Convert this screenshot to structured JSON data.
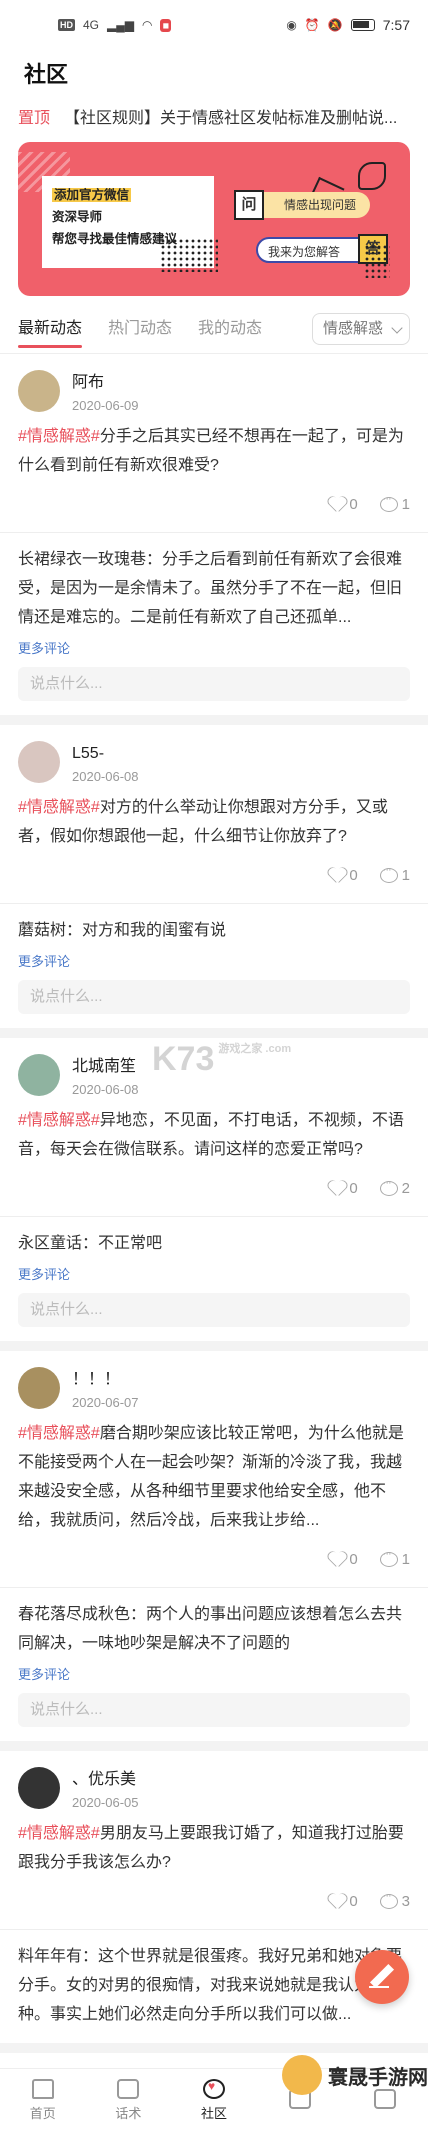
{
  "status_bar": {
    "left_badge": "HD",
    "signal": "4G",
    "time": "7:57"
  },
  "page_title": "社区",
  "notice": {
    "pin": "置顶",
    "text": "【社区规则】关于情感社区发帖标准及删帖说..."
  },
  "banner": {
    "line1": "添加官方微信",
    "line2": "资深导师",
    "line3": "帮您寻找最佳情感建议",
    "q_icon": "问",
    "q_text": "情感出现问题",
    "a_text": "我来为您解答",
    "a_icon": "答"
  },
  "tabs": {
    "items": [
      "最新动态",
      "热门动态",
      "我的动态"
    ],
    "select": "情感解惑"
  },
  "posts": [
    {
      "name": "阿布",
      "date": "2020-06-09",
      "tag": "#情感解惑#",
      "text": "分手之后其实已经不想再在一起了，可是为什么看到前任有新欢很难受?",
      "likes": "0",
      "comments": "1",
      "comment_user": "长裙绿衣一玫瑰巷：",
      "comment_text": "分手之后看到前任有新欢了会很难受，是因为一是余情未了。虽然分手了不在一起，但旧情还是难忘的。二是前任有新欢了自己还孤单...",
      "more": "更多评论",
      "reply_placeholder": "说点什么..."
    },
    {
      "name": "L55-",
      "date": "2020-06-08",
      "tag": "#情感解惑#",
      "text": "对方的什么举动让你想跟对方分手，又或者，假如你想跟他一起，什么细节让你放弃了?",
      "likes": "0",
      "comments": "1",
      "comment_user": "蘑菇树：",
      "comment_text": "对方和我的闺蜜有说",
      "more": "更多评论",
      "reply_placeholder": "说点什么..."
    },
    {
      "name": "北城南笙",
      "date": "2020-06-08",
      "tag": "#情感解惑#",
      "text": "异地恋，不见面，不打电话，不视频，不语音，每天会在微信联系。请问这样的恋爱正常吗?",
      "likes": "0",
      "comments": "2",
      "comment_user": "永区童话：",
      "comment_text": "不正常吧",
      "more": "更多评论",
      "reply_placeholder": "说点什么..."
    },
    {
      "name": "！！！",
      "date": "2020-06-07",
      "tag": "#情感解惑#",
      "text": "磨合期吵架应该比较正常吧，为什么他就是不能接受两个人在一起会吵架？渐渐的冷淡了我，我越来越没安全感，从各种细节里要求他给安全感，他不给，我就质问，然后冷战，后来我让步给...",
      "likes": "0",
      "comments": "1",
      "comment_user": "春花落尽成秋色：",
      "comment_text": "两个人的事出问题应该想着怎么去共同解决，一味地吵架是解决不了问题的",
      "more": "更多评论",
      "reply_placeholder": "说点什么..."
    },
    {
      "name": "、优乐美",
      "date": "2020-06-05",
      "tag": "#情感解惑#",
      "text": "男朋友马上要跟我订婚了，知道我打过胎要跟我分手我该怎么办?",
      "likes": "0",
      "comments": "3",
      "comment_user": "料年年有：",
      "comment_text": "这个世界就是很蛋疼。我好兄弟和她对象要分手。女的对男的很痴情，对我来说她就是我认为的那种。事实上她们必然走向分手所以我们可以做..."
    }
  ],
  "watermark_center": "K73",
  "watermark_center_small": "游戏之家 .com",
  "tabbar": [
    "首页",
    "话术",
    "社区",
    "",
    ""
  ],
  "watermark": "寰晟手游网",
  "colors": {
    "accent": "#e8505b",
    "banner": "#f0606a",
    "link": "#4a78c8",
    "fab": "#f26a50"
  }
}
